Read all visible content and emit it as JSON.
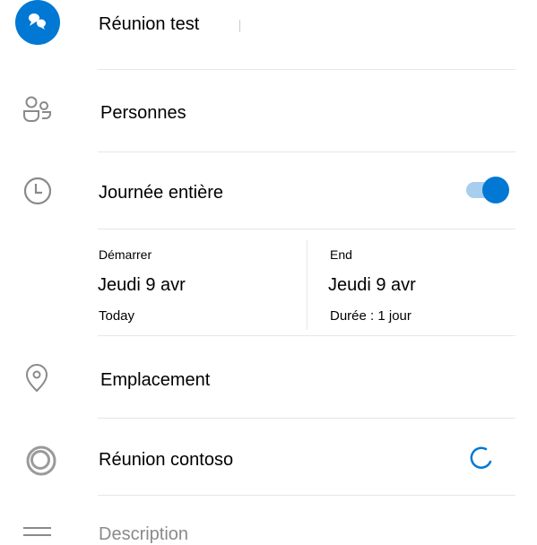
{
  "title": {
    "value": "Réunion test"
  },
  "people": {
    "label": "Personnes"
  },
  "all_day": {
    "label": "Journée entière",
    "enabled": true
  },
  "start": {
    "label": "Démarrer",
    "date": "Jeudi 9 avr",
    "sub": "Today"
  },
  "end": {
    "label": "End",
    "date": "Jeudi 9 avr",
    "sub": "Durée : 1 jour"
  },
  "location": {
    "label": "Emplacement"
  },
  "online_meeting": {
    "label": "Réunion contoso",
    "status": "loading"
  },
  "description": {
    "label": "Description"
  },
  "colors": {
    "accent": "#0078d4",
    "icon_gray": "#8a8a8a",
    "divider": "#e6e6e6"
  }
}
